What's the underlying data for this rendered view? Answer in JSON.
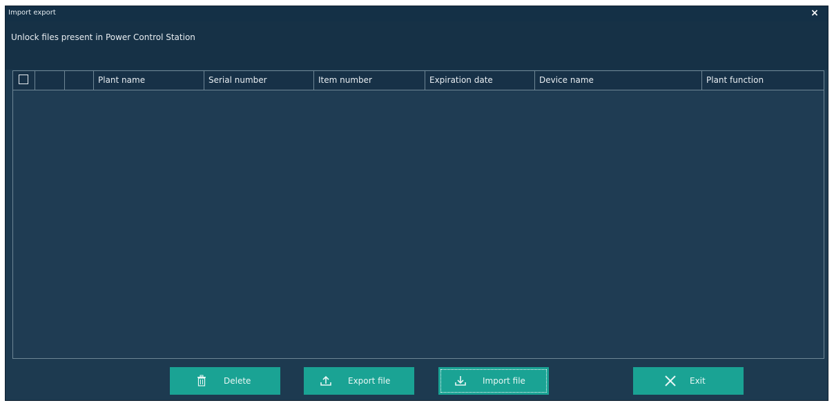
{
  "window": {
    "title": "Import export",
    "close_glyph": "×"
  },
  "header": {
    "label": "Unlock files present in Power Control Station"
  },
  "table": {
    "columns": [
      {
        "key": "select",
        "label": ""
      },
      {
        "key": "col2",
        "label": ""
      },
      {
        "key": "col3",
        "label": ""
      },
      {
        "key": "plant_name",
        "label": "Plant name"
      },
      {
        "key": "serial_number",
        "label": "Serial number"
      },
      {
        "key": "item_number",
        "label": "Item number"
      },
      {
        "key": "expiration_date",
        "label": "Expiration date"
      },
      {
        "key": "device_name",
        "label": "Device name"
      },
      {
        "key": "plant_function",
        "label": "Plant function"
      }
    ],
    "rows": []
  },
  "buttons": {
    "delete": {
      "label": "Delete",
      "icon": "trash-icon"
    },
    "export": {
      "label": "Export file",
      "icon": "upload-icon"
    },
    "import": {
      "label": "Import file",
      "icon": "download-icon"
    },
    "exit": {
      "label": "Exit",
      "icon": "close-icon"
    }
  },
  "colors": {
    "window_bg": "#1d3a50",
    "title_bg": "#143046",
    "accent": "#1aa394"
  }
}
